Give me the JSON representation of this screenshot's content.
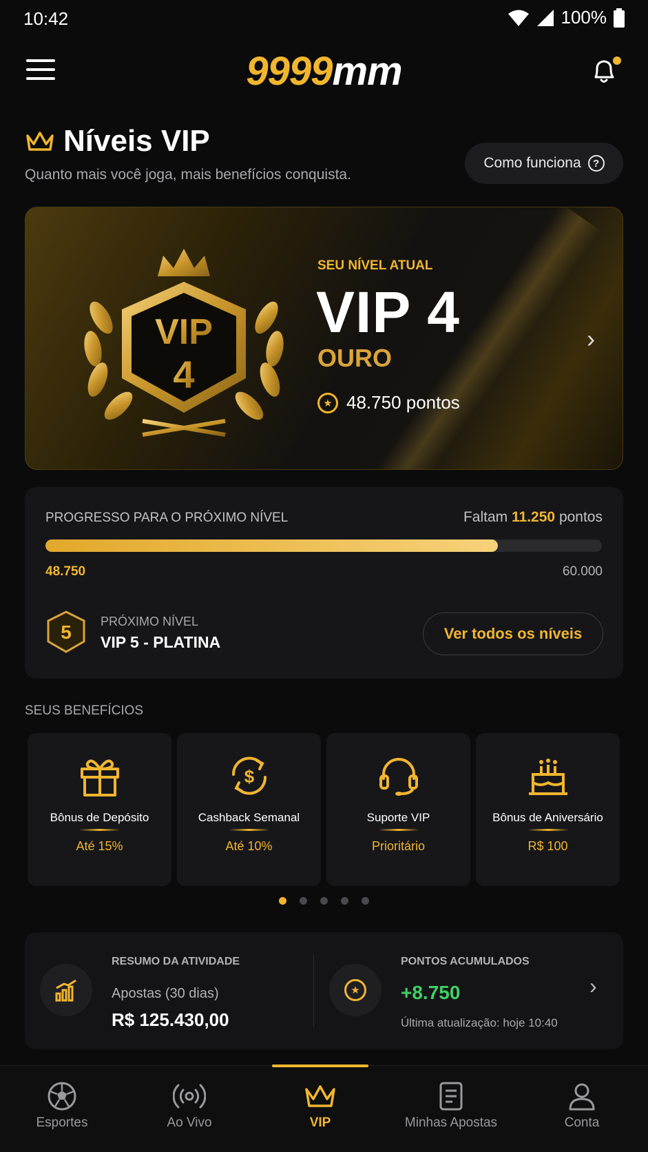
{
  "status_bar": {
    "time": "10:42",
    "battery": "100%"
  },
  "header": {
    "logo_number": "9999",
    "logo_text": "mm"
  },
  "page": {
    "title": "Níveis VIP",
    "subtitle": "Quanto mais você joga, mais benefícios conquista.",
    "how_it_works": "Como funciona"
  },
  "current_level": {
    "label": "SEU NÍVEL ATUAL",
    "name": "VIP 4",
    "tier": "OURO",
    "points": "48.750 pontos",
    "badge_top": "VIP",
    "badge_num": "4"
  },
  "progress": {
    "label": "PROGRESSO PARA O PRÓXIMO NÍVEL",
    "remaining_prefix": "Faltam",
    "remaining_value": "11.250",
    "remaining_suffix": "pontos",
    "current": "48.750",
    "max": "60.000",
    "fraction": 0.8125,
    "next_label": "PRÓXIMO NÍVEL",
    "next_name": "VIP 5 - PLATINA",
    "next_num": "5",
    "see_all": "Ver todos os níveis"
  },
  "benefits": {
    "heading": "SEUS BENEFÍCIOS",
    "items": [
      {
        "icon": "gift-icon",
        "title": "Bônus de Depósito",
        "value": "Até 15%"
      },
      {
        "icon": "cashback-icon",
        "title": "Cashback Semanal",
        "value": "Até 10%"
      },
      {
        "icon": "headset-icon",
        "title": "Suporte VIP",
        "value": "Prioritário"
      },
      {
        "icon": "cake-icon",
        "title": "Bônus de Aniversário",
        "value": "R$ 100"
      }
    ],
    "page_count": 5,
    "active_page": 1
  },
  "summary": {
    "label": "RESUMO DA ATIVIDADE",
    "sub": "Apostas (30 dias)",
    "value": "R$ 125.430,00",
    "points_label": "PONTOS ACUMULADOS",
    "points_value": "+8.750",
    "updated": "Última atualização: hoje 10:40"
  },
  "nav": {
    "items": [
      {
        "icon": "soccer-ball-icon",
        "label": "Esportes"
      },
      {
        "icon": "live-broadcast-icon",
        "label": "Ao Vivo"
      },
      {
        "icon": "crown-icon",
        "label": "VIP"
      },
      {
        "icon": "document-icon",
        "label": "Minhas Apostas"
      },
      {
        "icon": "user-icon",
        "label": "Conta"
      }
    ],
    "active": "VIP"
  },
  "colors": {
    "accent": "#f1b62f",
    "positive": "#3fcf63",
    "background": "#0b0b0c"
  }
}
